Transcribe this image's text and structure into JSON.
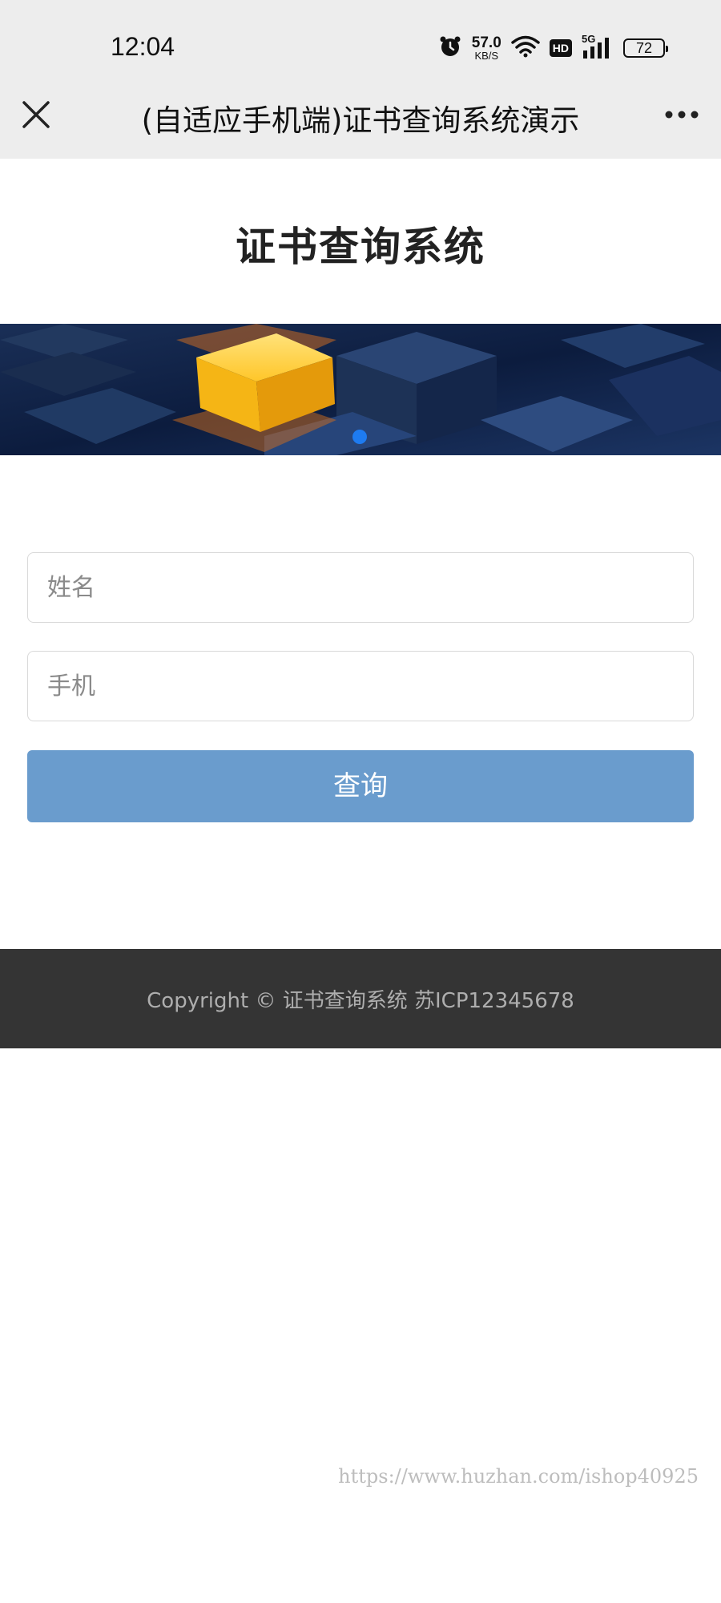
{
  "status_bar": {
    "time": "12:04",
    "net_speed_value": "57.0",
    "net_speed_unit": "KB/S",
    "network": "5G",
    "hd_badge": "HD",
    "battery": "72"
  },
  "nav": {
    "title": "(自适应手机端)证书查询系统演示"
  },
  "page": {
    "heading": "证书查询系统"
  },
  "form": {
    "name_placeholder": "姓名",
    "phone_placeholder": "手机",
    "submit_label": "查询",
    "submit_color": "#6a9ccd"
  },
  "footer": {
    "text": "Copyright © 证书查询系统 苏ICP12345678"
  },
  "watermark": "https://www.huzhan.com/ishop40925",
  "icons": [
    "alarm-icon",
    "wifi-icon",
    "signal-icon",
    "battery-icon",
    "close-icon",
    "more-icon"
  ]
}
